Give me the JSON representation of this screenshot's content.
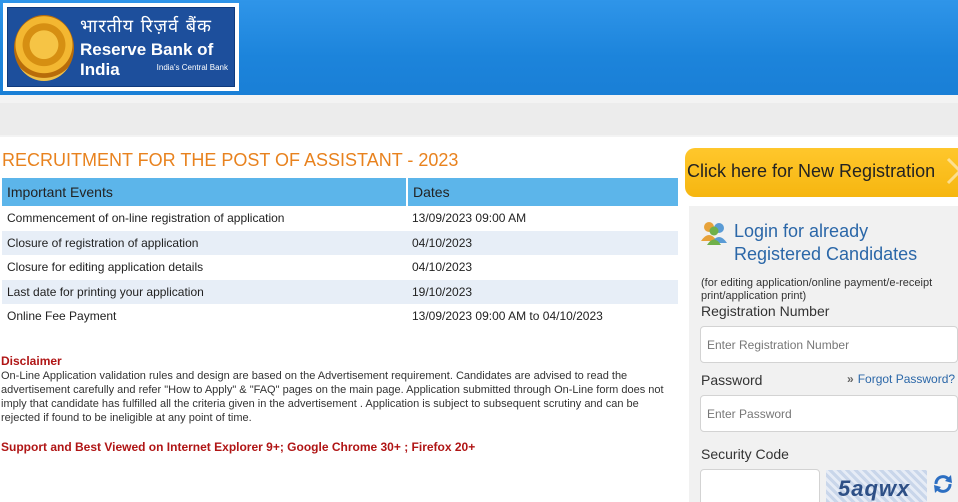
{
  "header": {
    "hindi_name": "भारतीय रिज़र्व बैंक",
    "english_name": "Reserve Bank of India",
    "tagline": "India's Central Bank",
    "background": "#1c84db"
  },
  "page": {
    "title": "RECRUITMENT FOR THE POST OF ASSISTANT - 2023",
    "title_color": "#e8821e"
  },
  "events_table": {
    "headers": [
      "Important Events",
      "Dates"
    ],
    "rows": [
      [
        "Commencement of on-line registration of application",
        "13/09/2023 09:00 AM"
      ],
      [
        "Closure of registration of application",
        "04/10/2023"
      ],
      [
        "Closure for editing application details",
        "04/10/2023"
      ],
      [
        "Last date for printing your application",
        "19/10/2023"
      ],
      [
        "Online Fee Payment",
        "13/09/2023 09:00 AM to 04/10/2023"
      ]
    ]
  },
  "disclaimer": {
    "title": "Disclaimer",
    "text": "On-Line Application validation rules and design are based on the Advertisement requirement. Candidates are advised to read the advertisement carefully and refer \"How to Apply\" & \"FAQ\" pages on the main page. Application submitted through On-Line form does not imply that candidate has fulfilled all the criteria given in the advertisement . Application is subject to subsequent scrutiny and can be rejected if found to be ineligible at any point of time.",
    "support": "Support and Best Viewed on Internet Explorer 9+; Google Chrome 30+ ; Firefox 20+"
  },
  "right": {
    "new_registration": "Click here for New Registration",
    "login_title_line1": "Login for already",
    "login_title_line2": "Registered Candidates",
    "login_note": "(for editing application/online payment/e-receipt print/application print)",
    "registration_label": "Registration Number",
    "registration_placeholder": "Enter Registration Number",
    "password_label": "Password",
    "forgot_password": "Forgot Password?",
    "password_placeholder": "Enter Password",
    "security_label": "Security Code",
    "captcha_text": "5aqwx",
    "accent": "#f6b610",
    "link_color": "#2b67a8"
  },
  "icons": [
    "rbi-emblem-icon",
    "users-icon",
    "chevron-right-icon",
    "refresh-icon"
  ]
}
